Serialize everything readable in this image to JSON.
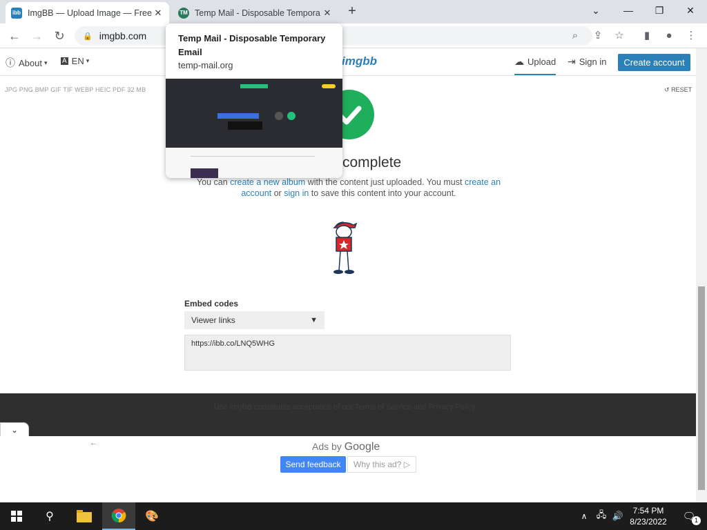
{
  "tabs": [
    {
      "favicon": "ibb",
      "title": "ImgBB — Upload Image — Free I",
      "active": true
    },
    {
      "favicon": "TM",
      "title": "Temp Mail - Disposable Tempora",
      "active": false
    }
  ],
  "address": {
    "url": "imgbb.com"
  },
  "header": {
    "about": "About",
    "lang": "EN",
    "logo": "imgbb",
    "upload": "Upload",
    "sign_in": "Sign in",
    "create_account": "Create account"
  },
  "upload": {
    "formats": "JPG PNG BMP GIF TIF WEBP HEIC PDF  32 MB",
    "reset": "RESET",
    "complete": "complete",
    "msg_1": "You can ",
    "msg_link_album": "create a new album",
    "msg_2": " with the content just uploaded. You must ",
    "msg_link_account": "create an account",
    "msg_3": " or ",
    "msg_link_signin": "sign in",
    "msg_4": " to save this content into your account."
  },
  "embed": {
    "label": "Embed codes",
    "selected": "Viewer links",
    "code": "https://ibb.co/LNQ5WHG"
  },
  "footer": {
    "text": "Use imgBB constitutes acceptance of our Terms of Service and Privacy Policy"
  },
  "ads": {
    "ads_by": "Ads by",
    "google": "Google",
    "send_feedback": "Send feedback",
    "why_this_ad": "Why this ad? ▷"
  },
  "hovercard": {
    "title": "Temp Mail - Disposable Temporary Email",
    "url": "temp-mail.org"
  },
  "taskbar": {
    "time": "7:54 PM",
    "date": "8/23/2022",
    "notifications": "1"
  },
  "colors": {
    "accent": "#2a80b9",
    "success": "#1fae5b"
  }
}
